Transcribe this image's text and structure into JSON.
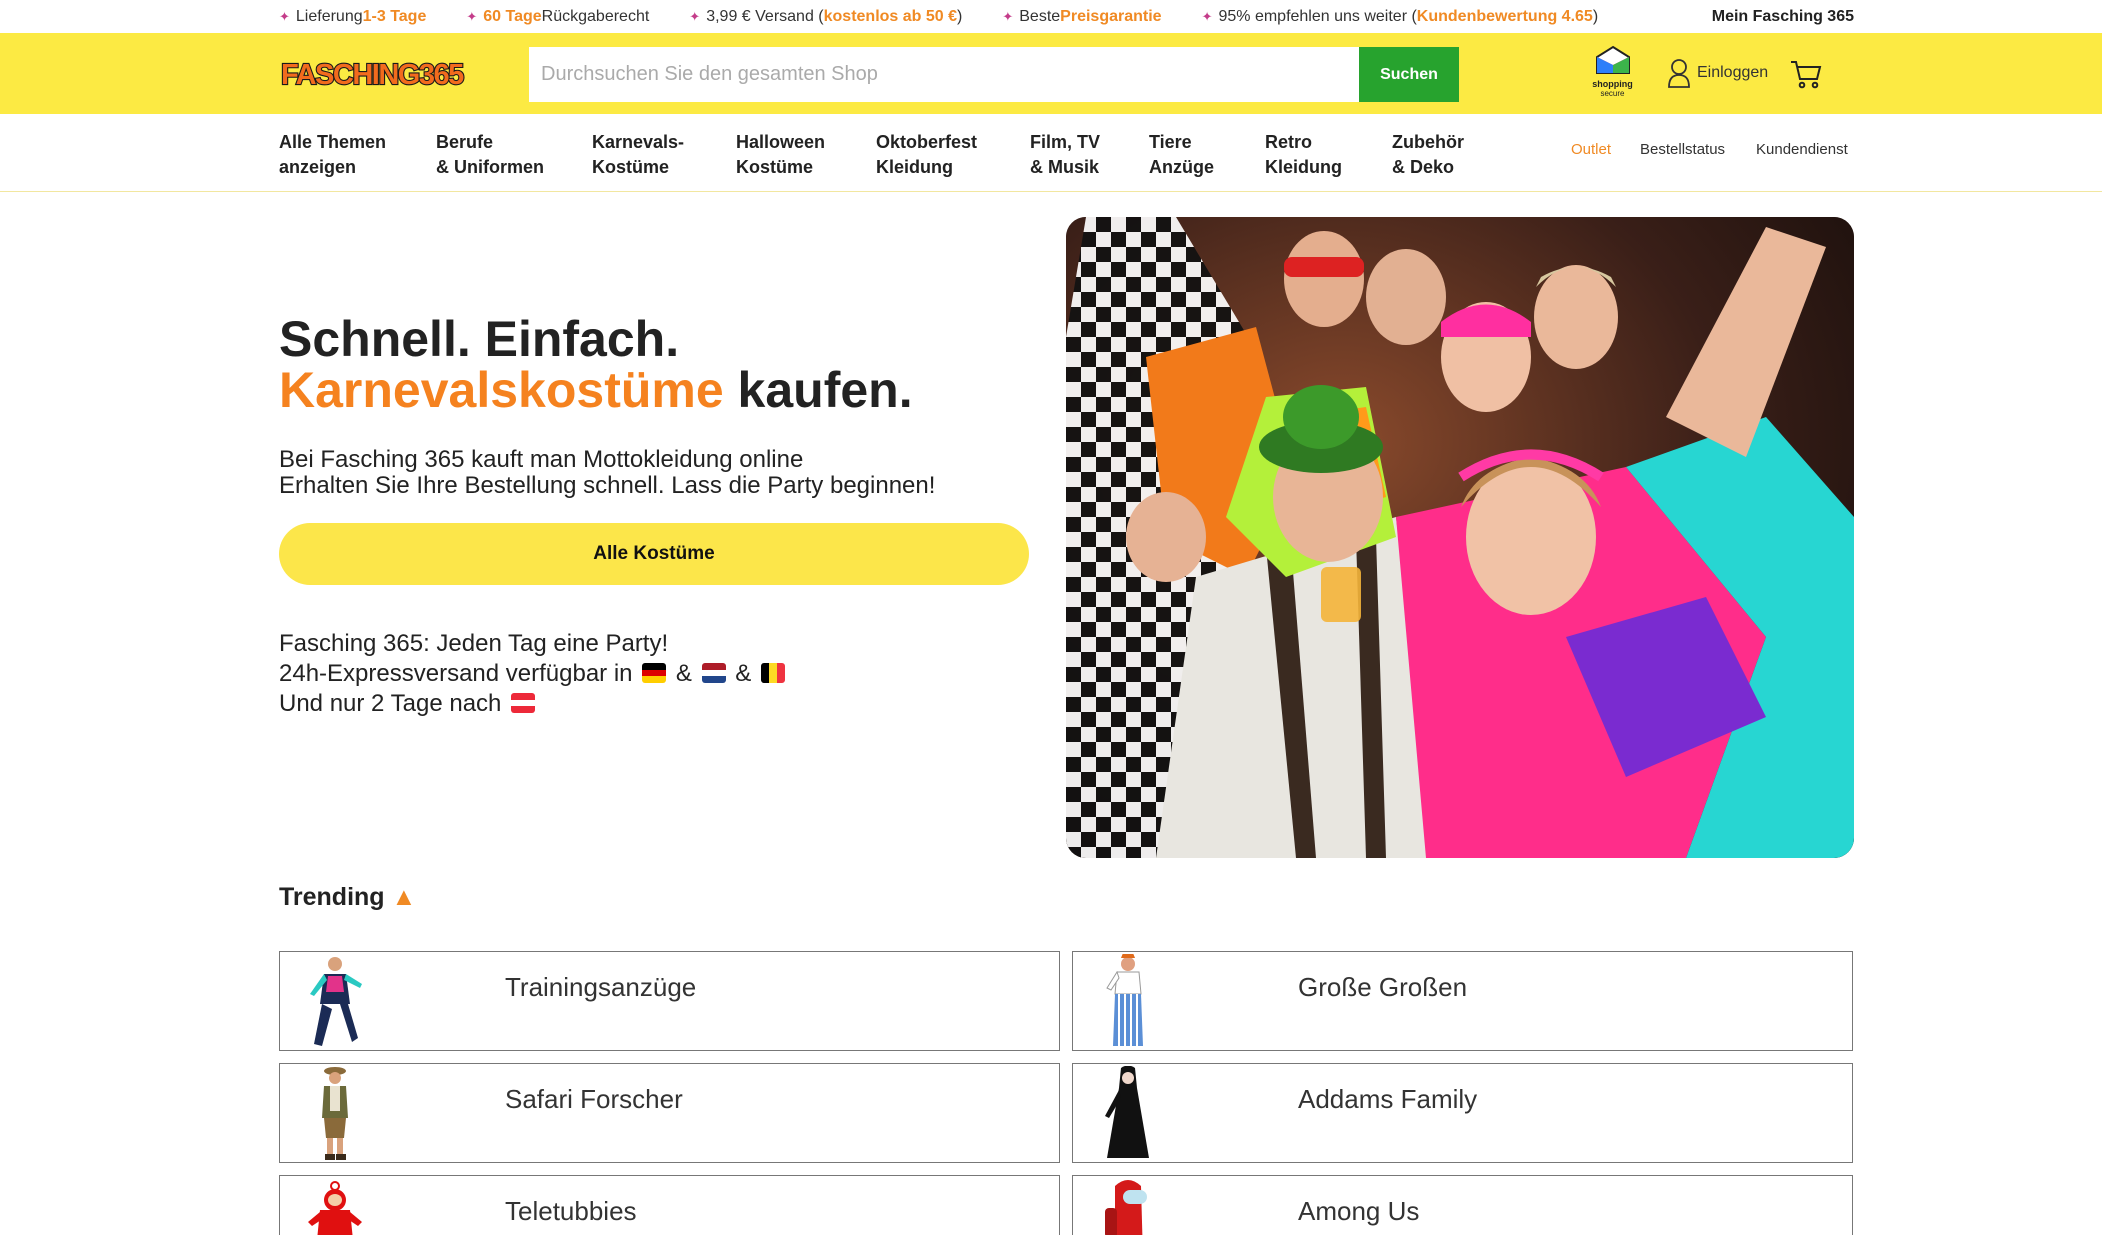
{
  "usp": [
    {
      "pre": "Lieferung ",
      "hl": "1-3 Tage",
      "post": ""
    },
    {
      "pre": "",
      "hl": "60 Tage",
      "post": " Rückgaberecht"
    },
    {
      "pre": "3,99 € Versand (",
      "hl": "kostenlos ab 50 €",
      "post": ")"
    },
    {
      "pre": "Beste ",
      "hl": "Preisgarantie",
      "post": ""
    },
    {
      "pre": "95% empfehlen uns weiter (",
      "hl": "Kundenbewertung 4.65",
      "post": ")"
    }
  ],
  "account_label": "Mein Fasching 365",
  "logo_text": "FASCHING365",
  "search": {
    "placeholder": "Durchsuchen Sie den gesamten Shop",
    "button": "Suchen"
  },
  "secure_badge": {
    "line1": "shopping",
    "line2": "secure"
  },
  "login_label": "Einloggen",
  "nav": [
    "Alle Themen\nanzeigen",
    "Berufe\n& Uniformen",
    "Karnevals-\nKostüme",
    "Halloween\nKostüme",
    "Oktoberfest\nKleidung",
    "Film, TV\n& Musik",
    "Tiere\nAnzüge",
    "Retro\nKleidung",
    "Zubehör\n& Deko"
  ],
  "nav_right": {
    "outlet": "Outlet",
    "order_status": "Bestellstatus",
    "service": "Kundendienst"
  },
  "hero": {
    "line1": "Schnell. Einfach.",
    "line2_orange": "Karnevalskostüme",
    "line2_rest": " kaufen.",
    "sub1": "Bei Fasching 365 kauft man Mottokleidung online",
    "sub2": "Erhalten Sie Ihre Bestellung schnell. Lass die Party beginnen!",
    "button": "Alle Kostüme",
    "info1": "Fasching 365: Jeden Tag eine Party!",
    "info2": "24h-Expressversand verfügbar in",
    "amp": "&",
    "info3": "Und nur 2 Tage nach"
  },
  "trending_title": "Trending",
  "trending": [
    {
      "name": "Trainingsanzüge",
      "icon": "tracksuit-figure"
    },
    {
      "name": "Große Großen",
      "icon": "overalls-figure"
    },
    {
      "name": "Safari Forscher",
      "icon": "safari-figure"
    },
    {
      "name": "Addams Family",
      "icon": "black-dress-figure"
    },
    {
      "name": "Teletubbies",
      "icon": "red-teletubby-figure"
    },
    {
      "name": "Among Us",
      "icon": "red-crewmate-figure"
    }
  ]
}
